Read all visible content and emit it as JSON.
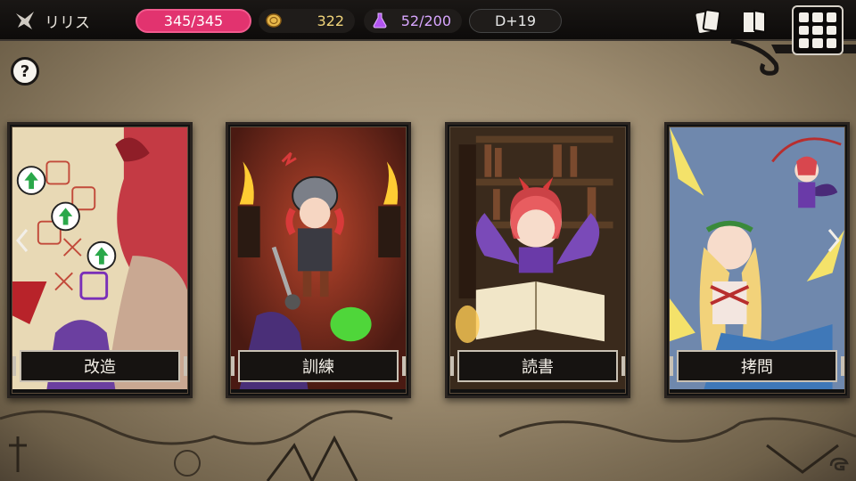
{
  "header": {
    "character_name": "リリス",
    "hp": "345/345",
    "gold": "322",
    "mana": "52/200",
    "day": "D+19"
  },
  "icons": {
    "character": "wing-icon",
    "gold": "coin-icon",
    "mana": "flask-icon",
    "cards": "cards-icon",
    "book": "book-icon",
    "menu": "grid-menu-icon",
    "help": "help-icon"
  },
  "help_label": "?",
  "cards": [
    {
      "label": "改造",
      "theme": "modify"
    },
    {
      "label": "訓練",
      "theme": "training"
    },
    {
      "label": "読書",
      "theme": "reading"
    },
    {
      "label": "拷問",
      "theme": "torture"
    }
  ],
  "colors": {
    "hp_pill": "#e2336f",
    "gold_text": "#f0d47a",
    "mana_text": "#d8a6ff",
    "topbar": "#0d0b0a",
    "parchment": "#9c8b6f"
  }
}
